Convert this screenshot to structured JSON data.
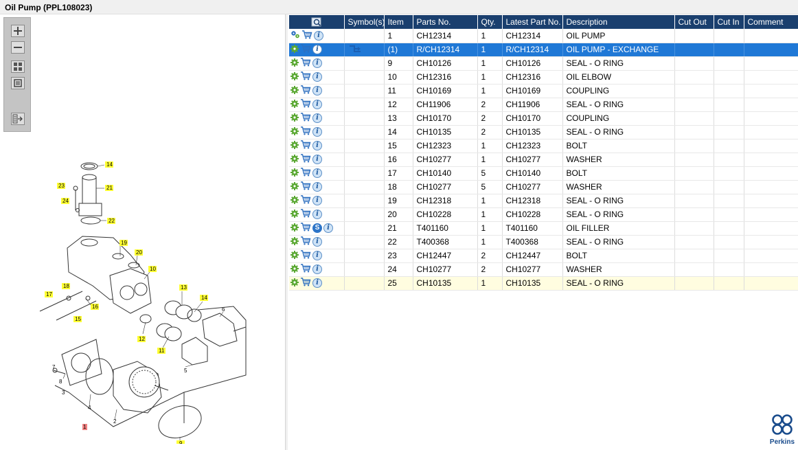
{
  "window": {
    "title": "Oil Pump (PPL108023)"
  },
  "toolbar": {
    "buttons": [
      "zoom-in",
      "zoom-out",
      "fit-all",
      "fit-window",
      "toggle-panel"
    ]
  },
  "table": {
    "headers": {
      "icon": "",
      "symbols": "Symbol(s)",
      "item": "Item",
      "part_no": "Parts No.",
      "qty": "Qty.",
      "latest": "Latest Part No.",
      "description": "Description",
      "cut_out": "Cut Out",
      "cut_in": "Cut In",
      "comment": "Comment"
    },
    "rows": [
      {
        "item": "1",
        "part_no": "CH12314",
        "qty": "1",
        "latest": "CH12314",
        "description": "OIL PUMP"
      },
      {
        "item": "(1)",
        "part_no": "R/CH12314",
        "qty": "1",
        "latest": "R/CH12314",
        "description": "OIL PUMP - EXCHANGE"
      },
      {
        "item": "9",
        "part_no": "CH10126",
        "qty": "1",
        "latest": "CH10126",
        "description": "SEAL - O RING"
      },
      {
        "item": "10",
        "part_no": "CH12316",
        "qty": "1",
        "latest": "CH12316",
        "description": "OIL ELBOW"
      },
      {
        "item": "11",
        "part_no": "CH10169",
        "qty": "1",
        "latest": "CH10169",
        "description": "COUPLING"
      },
      {
        "item": "12",
        "part_no": "CH11906",
        "qty": "2",
        "latest": "CH11906",
        "description": "SEAL - O RING"
      },
      {
        "item": "13",
        "part_no": "CH10170",
        "qty": "2",
        "latest": "CH10170",
        "description": "COUPLING"
      },
      {
        "item": "14",
        "part_no": "CH10135",
        "qty": "2",
        "latest": "CH10135",
        "description": "SEAL - O RING"
      },
      {
        "item": "15",
        "part_no": "CH12323",
        "qty": "1",
        "latest": "CH12323",
        "description": "BOLT"
      },
      {
        "item": "16",
        "part_no": "CH10277",
        "qty": "1",
        "latest": "CH10277",
        "description": "WASHER"
      },
      {
        "item": "17",
        "part_no": "CH10140",
        "qty": "5",
        "latest": "CH10140",
        "description": "BOLT"
      },
      {
        "item": "18",
        "part_no": "CH10277",
        "qty": "5",
        "latest": "CH10277",
        "description": "WASHER"
      },
      {
        "item": "19",
        "part_no": "CH12318",
        "qty": "1",
        "latest": "CH12318",
        "description": "SEAL - O RING"
      },
      {
        "item": "20",
        "part_no": "CH10228",
        "qty": "1",
        "latest": "CH10228",
        "description": "SEAL - O RING"
      },
      {
        "item": "21",
        "part_no": "T401160",
        "qty": "1",
        "latest": "T401160",
        "description": "OIL FILLER"
      },
      {
        "item": "22",
        "part_no": "T400368",
        "qty": "1",
        "latest": "T400368",
        "description": "SEAL - O RING"
      },
      {
        "item": "23",
        "part_no": "CH12447",
        "qty": "2",
        "latest": "CH12447",
        "description": "BOLT"
      },
      {
        "item": "24",
        "part_no": "CH10277",
        "qty": "2",
        "latest": "CH10277",
        "description": "WASHER"
      },
      {
        "item": "25",
        "part_no": "CH10135",
        "qty": "1",
        "latest": "CH10135",
        "description": "SEAL - O RING"
      }
    ],
    "selected_index": 1,
    "highlighted_index": 18,
    "s_symbol_index": 14,
    "s_symbol": "S",
    "info_symbol": "i"
  },
  "diagram": {
    "callouts": [
      "14",
      "23",
      "21",
      "24",
      "22",
      "19",
      "20",
      "10",
      "17",
      "18",
      "16",
      "15",
      "13",
      "14",
      "12",
      "11",
      "6",
      "7",
      "8",
      "3",
      "4",
      "5",
      "2",
      "9",
      "1"
    ]
  },
  "logo": {
    "text": "Perkins"
  },
  "colors": {
    "header": "#1a3f6e",
    "selected": "#1f78d6",
    "highlight_row": "#fffde0",
    "callout": "#ffff33",
    "callout_active": "#f08080"
  }
}
